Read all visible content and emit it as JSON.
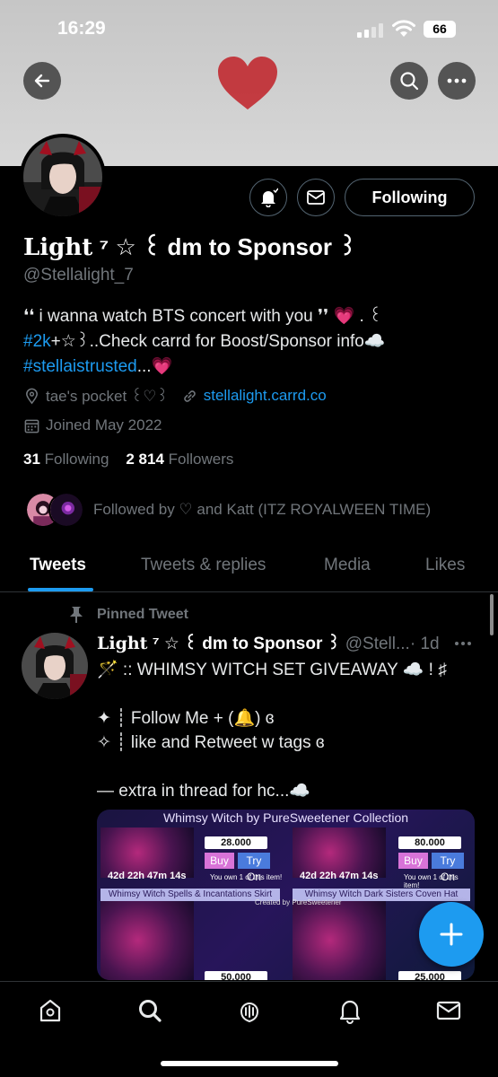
{
  "status": {
    "time": "16:29",
    "battery": "66"
  },
  "profile": {
    "display_name_part1": "Light",
    "display_name_part2": "⁷ ☆ ꒰ dm to Sponsor ꒱",
    "handle": "@Stellalight_7",
    "bio_line1": "❛❛ i wanna watch BTS concert with you ❜❜ 💗 . ꒰",
    "bio_hashtag1": "#2k",
    "bio_line2_rest": "+☆꒱..Check carrd for Boost/Sponsor info☁️",
    "bio_hashtag2": "#stellaistrusted",
    "bio_line3_rest": "...💗",
    "location": "tae's pocket ꒰♡꒱",
    "website": "stellalight.carrd.co",
    "joined": "Joined May 2022",
    "following_count": "31",
    "following_label": "Following",
    "followers_count": "2 814",
    "followers_label": "Followers",
    "followed_by": "Followed by ♡ and Katt (ITZ ROYALWEEN TIME)",
    "follow_button": "Following"
  },
  "tabs": [
    {
      "label": "Tweets",
      "active": true
    },
    {
      "label": "Tweets & replies",
      "active": false
    },
    {
      "label": "Media",
      "active": false
    },
    {
      "label": "Likes",
      "active": false
    }
  ],
  "pinned_tweet": {
    "pinned_label": "Pinned Tweet",
    "author_name_part1": "Light",
    "author_name_part2": "⁷ ☆ ꒰ dm to Sponsor ꒱",
    "author_handle": "@Stell...",
    "time": "· 1d",
    "lines": [
      "🪄 :: WHIMSY WITCH SET GIVEAWAY ☁️ ! ♯",
      "",
      "✦ ┊ Follow Me + (🔔) ɞ",
      "✧ ┊ like and Retweet w tags ɞ",
      "",
      "— extra in thread for hc...☁️"
    ],
    "media": {
      "title": "Whimsy Witch by PureSweetener Collection",
      "prices": [
        "28.000",
        "80.000",
        "50.000",
        "25.000"
      ],
      "buy": "Buy",
      "try_on": "Try On",
      "timers": [
        "42d 22h 47m 14s",
        "42d 22h 47m 14s"
      ],
      "own_text": "You own 1 of this item!",
      "item_labels": [
        "Whimsy Witch Spells & Incantations Skirt",
        "Whimsy Witch Dark Sisters Coven Hat"
      ],
      "created_by": "Created by PureSweetener"
    }
  },
  "colors": {
    "accent": "#1d9bf0",
    "background": "#000000",
    "muted": "#71767b",
    "border": "#2f3336",
    "banner": "#cfcfcf",
    "heart": "#c0262c"
  },
  "icons": [
    "back-arrow-icon",
    "search-icon",
    "more-icon",
    "bell-icon",
    "mail-icon",
    "location-icon",
    "link-icon",
    "calendar-icon",
    "pin-icon",
    "compose-plus-icon",
    "home-icon",
    "explore-icon",
    "spaces-icon",
    "notifications-icon",
    "messages-icon"
  ]
}
